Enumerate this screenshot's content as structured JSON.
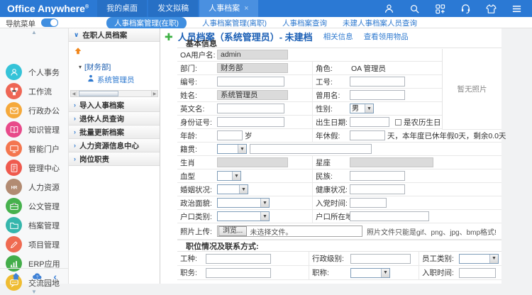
{
  "colors": {
    "topbar": "#2b79d4",
    "accent": "#3f8ee0",
    "link": "#2e79cf",
    "title": "#1b5fb5",
    "plus": "#3cb043"
  },
  "topbar": {
    "logo": "Office Anywhere",
    "logo_sup": "®",
    "tabs": [
      {
        "label": "我的桌面"
      },
      {
        "label": "发文拟稿"
      },
      {
        "label": "人事档案",
        "active": true
      }
    ],
    "icons": [
      "user-icon",
      "search-icon",
      "apps-icon",
      "support-icon",
      "theme-icon",
      "menu-icon"
    ]
  },
  "subnav": {
    "nav_toggle_label": "导航菜单",
    "tabs": [
      "人事档案管理(在职)",
      "人事档案管理(离职)",
      "人事档案查询",
      "未建人事档案人员查询"
    ]
  },
  "sidebar": {
    "items": [
      {
        "label": "个人事务",
        "color": "#35c3d8"
      },
      {
        "label": "工作流",
        "color": "#ee6655"
      },
      {
        "label": "行政办公",
        "color": "#f5a93b"
      },
      {
        "label": "知识管理",
        "color": "#e84a8a"
      },
      {
        "label": "智能门户",
        "color": "#f4764f"
      },
      {
        "label": "管理中心",
        "color": "#ef5a4e"
      },
      {
        "label": "人力资源",
        "color": "#b28b72"
      },
      {
        "label": "公文管理",
        "color": "#46b14d"
      },
      {
        "label": "档案管理",
        "color": "#35b6ac"
      },
      {
        "label": "项目管理",
        "color": "#ef6a51"
      },
      {
        "label": "ERP应用",
        "color": "#43ad4a"
      },
      {
        "label": "交流园地",
        "color": "#efbc31"
      }
    ]
  },
  "tree_panel": {
    "panels": [
      {
        "label": "在职人员档案",
        "expanded": true
      },
      {
        "label": "导入人事档案"
      },
      {
        "label": "退休人员查询"
      },
      {
        "label": "批量更新档案"
      },
      {
        "label": "人力资源信息中心"
      },
      {
        "label": "岗位职责"
      }
    ],
    "tree": {
      "dept": "[财务部]",
      "user": "系统管理员"
    }
  },
  "main": {
    "title": "人员档案（系统管理员）- 未建档",
    "links": [
      "相关信息",
      "查看领用物品"
    ],
    "photo_placeholder": "暂无照片",
    "form": {
      "section1": "基本信息",
      "section2": "职位情况及联系方式:",
      "oa_user": {
        "label": "OA用户名:",
        "value": "admin"
      },
      "dept": {
        "label": "部门:",
        "value": "财务部"
      },
      "role": {
        "label": "角色:",
        "value": "OA 管理员"
      },
      "code": {
        "label": "编号:"
      },
      "work_no": {
        "label": "工号:"
      },
      "name": {
        "label": "姓名:",
        "value": "系统管理员"
      },
      "former": {
        "label": "曾用名:"
      },
      "english": {
        "label": "英文名:"
      },
      "gender": {
        "label": "性别:",
        "value": "男"
      },
      "id_no": {
        "label": "身份证号:"
      },
      "birth": {
        "label": "出生日期:",
        "checkbox": "是农历生日"
      },
      "age": {
        "label": "年龄:",
        "suffix": "岁"
      },
      "leave": {
        "label": "年休假:",
        "suffix": "天，本年度已休年假0天，剩余0.0天"
      },
      "native": {
        "label": "籍贯:"
      },
      "zodiac": {
        "label": "生肖"
      },
      "constel": {
        "label": "星座"
      },
      "blood": {
        "label": "血型"
      },
      "ethnic": {
        "label": "民族:"
      },
      "marital": {
        "label": "婚姻状况:"
      },
      "health": {
        "label": "健康状况:"
      },
      "political": {
        "label": "政治面貌:"
      },
      "party": {
        "label": "入党时间:"
      },
      "hukou_type": {
        "label": "户口类别:"
      },
      "hukou_loc": {
        "label": "户口所在地:"
      },
      "upload": {
        "label": "照片上传:",
        "browse": "浏览...",
        "no_file": "未选择文件。",
        "hint": "照片文件只能是gif、png、jpg、bmp格式!"
      },
      "work_type": {
        "label": "工种:"
      },
      "adm_level": {
        "label": "行政级别:"
      },
      "emp_type": {
        "label": "员工类别:"
      },
      "position": {
        "label": "职务:"
      },
      "job_title": {
        "label": "职称:"
      },
      "hire_date": {
        "label": "入职时间:"
      }
    }
  }
}
